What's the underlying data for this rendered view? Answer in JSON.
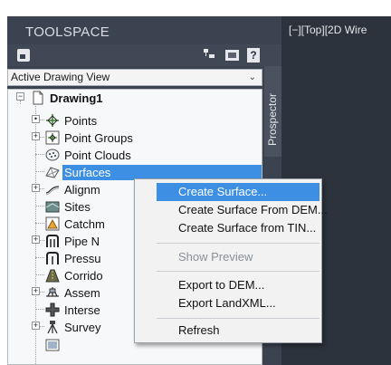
{
  "toolspace": {
    "title": "TOOLSPACE",
    "view_selector": "Active Drawing View",
    "side_tab": "Prospector"
  },
  "tree": {
    "root": "Drawing1",
    "items": [
      {
        "label": "Points",
        "icon": "points-icon"
      },
      {
        "label": "Point Groups",
        "icon": "point-groups-icon"
      },
      {
        "label": "Point Clouds",
        "icon": "point-clouds-icon"
      },
      {
        "label": "Surfaces",
        "icon": "surfaces-icon"
      },
      {
        "label": "Alignm",
        "icon": "alignments-icon"
      },
      {
        "label": "Sites",
        "icon": "sites-icon"
      },
      {
        "label": "Catchm",
        "icon": "catchments-icon"
      },
      {
        "label": "Pipe N",
        "icon": "pipe-networks-icon"
      },
      {
        "label": "Pressu",
        "icon": "pressure-networks-icon"
      },
      {
        "label": "Corrido",
        "icon": "corridors-icon"
      },
      {
        "label": "Assem",
        "icon": "assemblies-icon"
      },
      {
        "label": "Interse",
        "icon": "intersections-icon"
      },
      {
        "label": "Survey",
        "icon": "survey-icon"
      }
    ],
    "selected": "Surfaces"
  },
  "context_menu": {
    "items": [
      {
        "label": "Create Surface...",
        "highlighted": true
      },
      {
        "label": "Create Surface From DEM..."
      },
      {
        "label": "Create Surface from TIN..."
      },
      {
        "label": "Show Preview",
        "disabled": true
      },
      {
        "label": "Export to DEM..."
      },
      {
        "label": "Export LandXML..."
      },
      {
        "label": "Refresh"
      }
    ]
  },
  "viewport": {
    "label": "[−][Top][2D Wire"
  },
  "colors": {
    "panel_dark": "#3b4350",
    "selection_blue": "#3d8fe4",
    "viewport_bg": "#2d333c"
  }
}
